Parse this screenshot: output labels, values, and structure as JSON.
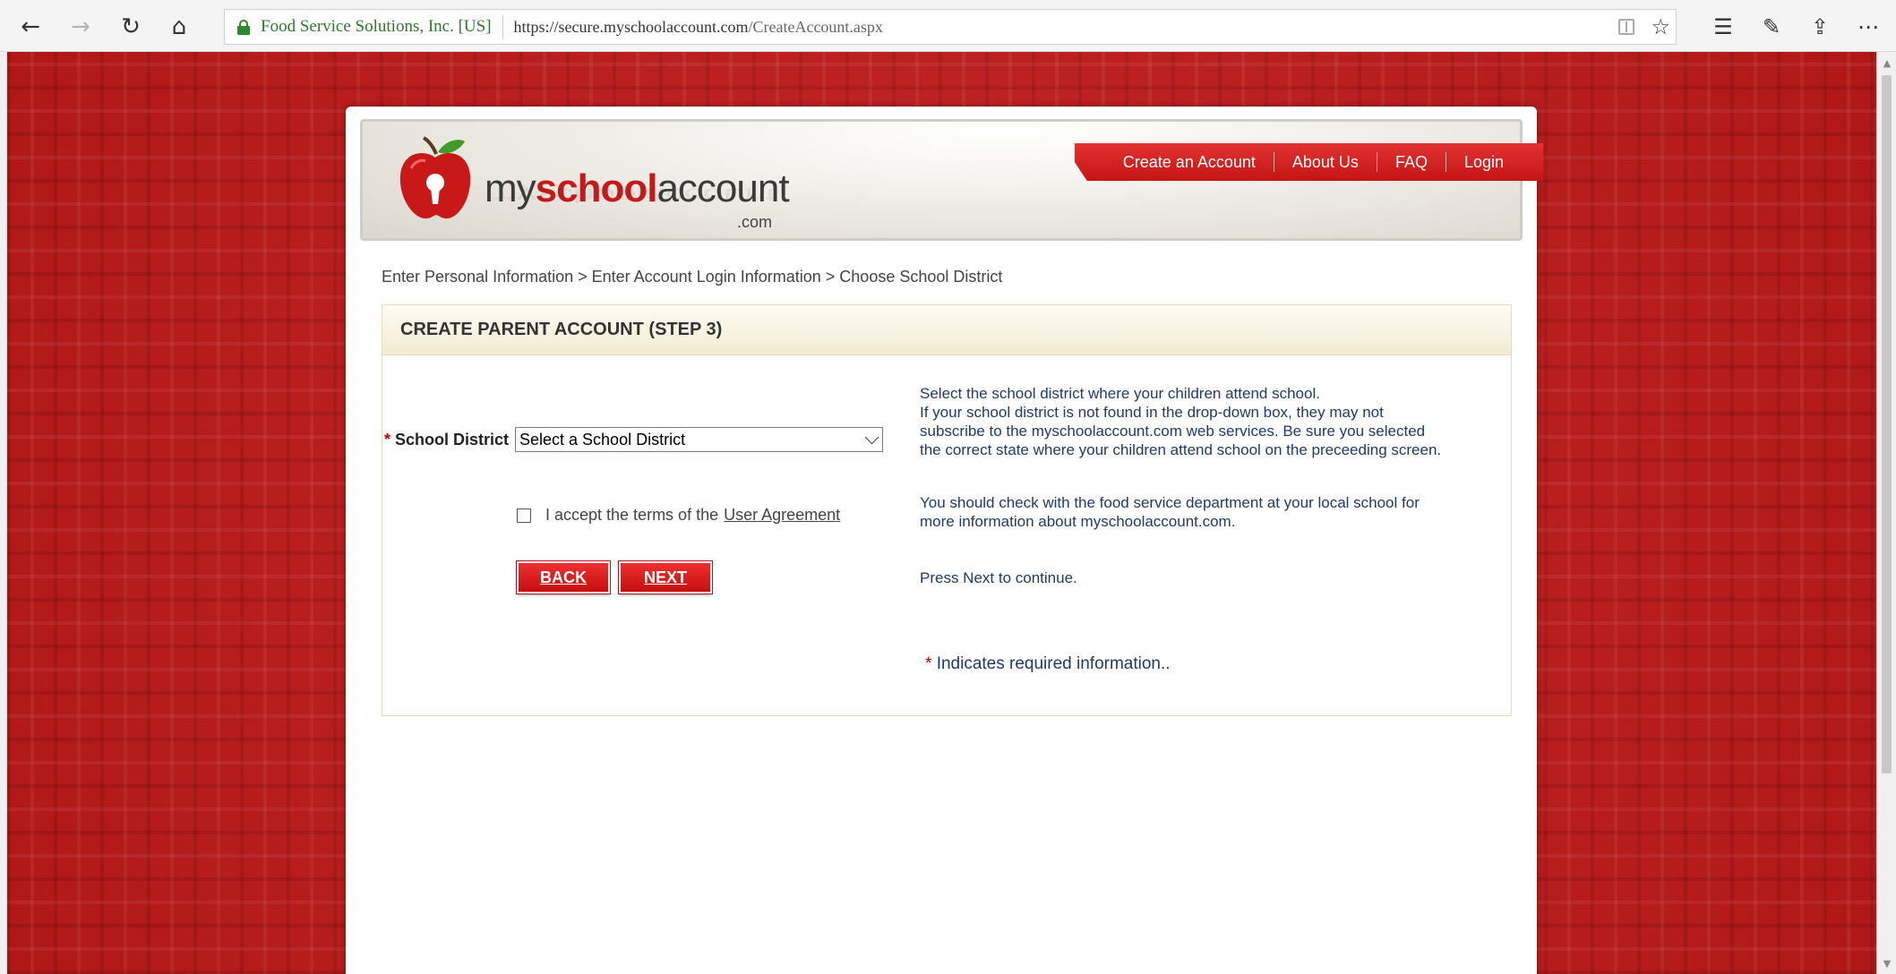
{
  "browser": {
    "site_identity": "Food Service Solutions, Inc. [US]",
    "url_host": "https://secure.myschoolaccount.com",
    "url_path": "/CreateAccount.aspx",
    "icons": [
      "back-icon",
      "forward-icon",
      "refresh-icon",
      "home-icon",
      "lock-icon",
      "reading-view-icon",
      "favorite-star-icon",
      "favorites-hub-icon",
      "web-note-icon",
      "share-icon",
      "more-icon"
    ]
  },
  "header": {
    "logo_my": "my",
    "logo_school": "school",
    "logo_account": "account",
    "logo_dotcom": ".com",
    "nav": [
      "Create an Account",
      "About Us",
      "FAQ",
      "Login"
    ]
  },
  "breadcrumb": "Enter Personal Information > Enter Account Login Information > Choose School District",
  "form": {
    "title": "CREATE PARENT ACCOUNT (STEP 3)",
    "required_marker": "*",
    "school_district_label": "School District",
    "school_district_value": "Select a School District",
    "agree_text": "I accept the terms of the",
    "agree_link": "User Agreement",
    "back_label": "BACK",
    "next_label": "NEXT"
  },
  "help": {
    "district_text": "Select the school district where your children attend school.\nIf your school district is not found in the drop-down box, they may not\nsubscribe to the myschoolaccount.com web services. Be sure you selected\nthe correct state where your children attend school on the preceeding screen.",
    "agreement_text": "You should check with the food service department at your local school for\nmore information about myschoolaccount.com.",
    "next_text": "Press Next to continue.",
    "required_note": "Indicates required information.."
  },
  "colors": {
    "brand_red": "#c61a1a",
    "help_text": "#1f3a6b",
    "background_red": "#b71c1c",
    "step_header": "#f3ecd3"
  }
}
